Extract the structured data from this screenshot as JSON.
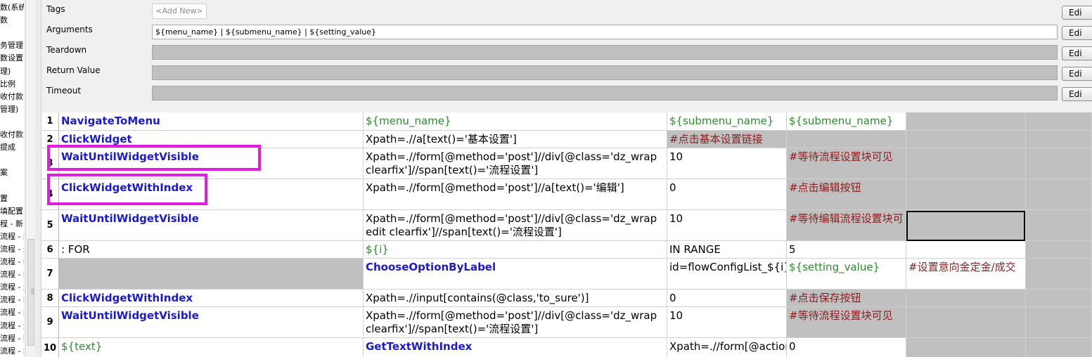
{
  "tree": {
    "items": [
      "数(系统",
      "数",
      "",
      "务管理",
      "数设置",
      "理)",
      "比例",
      "收付款",
      "管理)",
      "",
      "收付款",
      "提成",
      "",
      "案",
      "",
      "置",
      "填配置",
      "程 - 新",
      "流程 - 编",
      "流程 - 删",
      "流程 - 新",
      "流程 - 编",
      "流程 - 删",
      "流程 - 新",
      "流程 - 编",
      "流程 - 删",
      "流程 - 新",
      "流程 - 编"
    ]
  },
  "settings": {
    "tags": {
      "label": "Tags",
      "add_new": "<Add New>"
    },
    "arguments": {
      "label": "Arguments",
      "value": "${menu_name} | ${submenu_name} | ${setting_value}"
    },
    "teardown": {
      "label": "Teardown"
    },
    "return_value": {
      "label": "Return Value"
    },
    "timeout": {
      "label": "Timeout"
    },
    "edit_label": "Edi"
  },
  "grid": {
    "rows": [
      {
        "num": "1",
        "cells": [
          "NavigateToMenu",
          "${menu_name}",
          "${submenu_name}",
          "${submenu_name}",
          "",
          ""
        ]
      },
      {
        "num": "2",
        "cells": [
          "ClickWidget",
          "Xpath=.//a[text()='基本设置']",
          "#点击基本设置链接",
          "",
          "",
          ""
        ]
      },
      {
        "num": "3",
        "cells": [
          "WaitUntilWidgetVisible",
          "Xpath=.//form[@method='post']//div[@class='dz_wrap clearfix']//span[text()='流程设置']",
          "10",
          "#等待流程设置块可见",
          "",
          ""
        ]
      },
      {
        "num": "4",
        "cells": [
          "ClickWidgetWithIndex",
          "Xpath=.//form[@method='post']//a[text()='编辑']",
          "0",
          "#点击编辑按钮",
          "",
          ""
        ]
      },
      {
        "num": "5",
        "cells": [
          "WaitUntilWidgetVisible",
          "Xpath=.//form[@method='post']//div[@class='dz_wrap edit clearfix']//span[text()='流程设置']",
          "10",
          "#等待编辑流程设置块可",
          "",
          ""
        ]
      },
      {
        "num": "6",
        "cells": [
          ": FOR",
          "${i}",
          "IN RANGE",
          "5",
          "",
          ""
        ]
      },
      {
        "num": "7",
        "cells": [
          "",
          "ChooseOptionByLabel",
          "id=flowConfigList_${i}_",
          "${setting_value}",
          "#设置意向金定金/成交",
          ""
        ]
      },
      {
        "num": "8",
        "cells": [
          "ClickWidgetWithIndex",
          "Xpath=.//input[contains(@class,'to_sure')]",
          "0",
          "#点击保存按钮",
          "",
          ""
        ]
      },
      {
        "num": "9",
        "cells": [
          "WaitUntilWidgetVisible",
          "Xpath=.//form[@method='post']//div[@class='dz_wrap clearfix']//span[text()='流程设置']",
          "10",
          "#等待流程设置块可见",
          "",
          ""
        ]
      },
      {
        "num": "10",
        "cells": [
          "${text}",
          "GetTextWithIndex",
          "Xpath=.//form[@action",
          "0",
          "",
          ""
        ]
      }
    ]
  },
  "colors": {
    "keyword": "#1a1ad4",
    "variable": "#2a8c2a",
    "comment": "#8b2020",
    "highlight": "#e01ee0",
    "empty_cell": "#c0c0c0"
  }
}
